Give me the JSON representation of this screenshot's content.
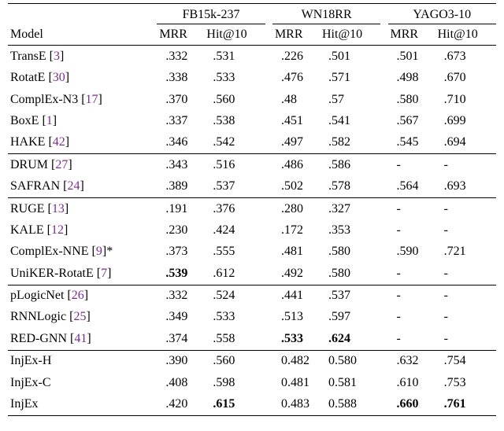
{
  "chart_data": {
    "type": "table",
    "title": "",
    "datasets": [
      "FB15k-237",
      "WN18RR",
      "YAGO3-10"
    ],
    "metrics": [
      "MRR",
      "Hit@10"
    ],
    "groups": [
      [
        {
          "model": "TransE",
          "ref": "3",
          "star": false,
          "vals": [
            ".332",
            ".531",
            ".226",
            ".501",
            ".501",
            ".673"
          ],
          "bold": [
            false,
            false,
            false,
            false,
            false,
            false
          ]
        },
        {
          "model": "RotatE",
          "ref": "30",
          "star": false,
          "vals": [
            ".338",
            ".533",
            ".476",
            ".571",
            ".498",
            ".670"
          ],
          "bold": [
            false,
            false,
            false,
            false,
            false,
            false
          ]
        },
        {
          "model": "ComplEx-N3",
          "ref": "17",
          "star": false,
          "vals": [
            ".370",
            ".560",
            ".48",
            ".57",
            ".580",
            ".710"
          ],
          "bold": [
            false,
            false,
            false,
            false,
            false,
            false
          ]
        },
        {
          "model": "BoxE",
          "ref": "1",
          "star": false,
          "vals": [
            ".337",
            ".538",
            ".451",
            ".541",
            ".567",
            ".699"
          ],
          "bold": [
            false,
            false,
            false,
            false,
            false,
            false
          ]
        },
        {
          "model": "HAKE",
          "ref": "42",
          "star": false,
          "vals": [
            ".346",
            ".542",
            ".497",
            ".582",
            ".545",
            ".694"
          ],
          "bold": [
            false,
            false,
            false,
            false,
            false,
            false
          ]
        }
      ],
      [
        {
          "model": "DRUM",
          "ref": "27",
          "star": false,
          "vals": [
            ".343",
            ".516",
            ".486",
            ".586",
            "-",
            "-"
          ],
          "bold": [
            false,
            false,
            false,
            false,
            false,
            false
          ]
        },
        {
          "model": "SAFRAN",
          "ref": "24",
          "star": false,
          "vals": [
            ".389",
            ".537",
            ".502",
            ".578",
            ".564",
            ".693"
          ],
          "bold": [
            false,
            false,
            false,
            false,
            false,
            false
          ]
        }
      ],
      [
        {
          "model": "RUGE",
          "ref": "13",
          "star": false,
          "vals": [
            ".191",
            ".376",
            ".280",
            ".327",
            "-",
            "-"
          ],
          "bold": [
            false,
            false,
            false,
            false,
            false,
            false
          ]
        },
        {
          "model": "KALE",
          "ref": "12",
          "star": false,
          "vals": [
            ".230",
            ".424",
            ".172",
            ".353",
            "-",
            "-"
          ],
          "bold": [
            false,
            false,
            false,
            false,
            false,
            false
          ]
        },
        {
          "model": "ComplEx-NNE",
          "ref": "9",
          "star": true,
          "vals": [
            ".373",
            ".555",
            ".481",
            ".580",
            ".590",
            ".721"
          ],
          "bold": [
            false,
            false,
            false,
            false,
            false,
            false
          ]
        },
        {
          "model": "UniKER-RotatE",
          "ref": "7",
          "star": false,
          "vals": [
            ".539",
            ".612",
            ".492",
            ".580",
            "-",
            "-"
          ],
          "bold": [
            true,
            false,
            false,
            false,
            false,
            false
          ]
        }
      ],
      [
        {
          "model": "pLogicNet",
          "ref": "26",
          "star": false,
          "vals": [
            ".332",
            ".524",
            ".441",
            ".537",
            "-",
            "-"
          ],
          "bold": [
            false,
            false,
            false,
            false,
            false,
            false
          ]
        },
        {
          "model": "RNNLogic",
          "ref": "25",
          "star": false,
          "vals": [
            ".349",
            ".533",
            ".513",
            ".597",
            "-",
            "-"
          ],
          "bold": [
            false,
            false,
            false,
            false,
            false,
            false
          ]
        },
        {
          "model": "RED-GNN",
          "ref": "41",
          "star": false,
          "vals": [
            ".374",
            ".558",
            ".533",
            ".624",
            "-",
            "-"
          ],
          "bold": [
            false,
            false,
            true,
            true,
            false,
            false
          ]
        }
      ],
      [
        {
          "model": "InjEx-H",
          "ref": null,
          "star": false,
          "vals": [
            ".390",
            ".560",
            "0.482",
            "0.580",
            ".632",
            ".754"
          ],
          "bold": [
            false,
            false,
            false,
            false,
            false,
            false
          ]
        },
        {
          "model": "InjEx-C",
          "ref": null,
          "star": false,
          "vals": [
            ".408",
            ".598",
            "0.481",
            "0.581",
            ".610",
            ".753"
          ],
          "bold": [
            false,
            false,
            false,
            false,
            false,
            false
          ]
        },
        {
          "model": "InjEx",
          "ref": null,
          "star": false,
          "vals": [
            ".420",
            ".615",
            "0.483",
            "0.588",
            ".660",
            ".761"
          ],
          "bold": [
            false,
            true,
            false,
            false,
            true,
            true
          ]
        }
      ]
    ]
  },
  "labels": {
    "model_header": "Model",
    "mrr": "MRR",
    "hit": "Hit@10"
  }
}
